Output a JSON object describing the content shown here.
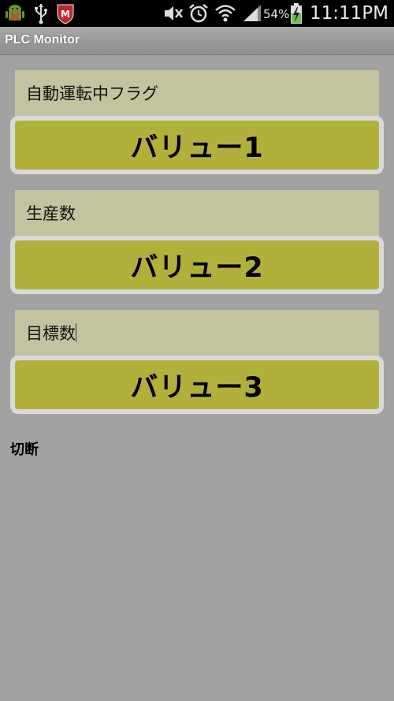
{
  "status_bar": {
    "battery_percent": "54%",
    "time": "11:11PM",
    "icons": [
      "android-debug-icon",
      "usb-icon",
      "mcafee-icon",
      "mute-icon",
      "alarm-icon",
      "wifi-icon",
      "signal-icon",
      "battery-charging-icon"
    ]
  },
  "app": {
    "title": "PLC Monitor"
  },
  "fields": [
    {
      "label": "自動運転中フラグ",
      "value": "バリュー1"
    },
    {
      "label": "生産数",
      "value": "バリュー2"
    },
    {
      "label": "目標数",
      "value": "バリュー3"
    }
  ],
  "disconnect_label": "切断",
  "colors": {
    "background": "#a2a2a2",
    "label_bg": "#c4c39f",
    "value_bg": "#b1b03b",
    "value_border": "#d9d9d9"
  }
}
